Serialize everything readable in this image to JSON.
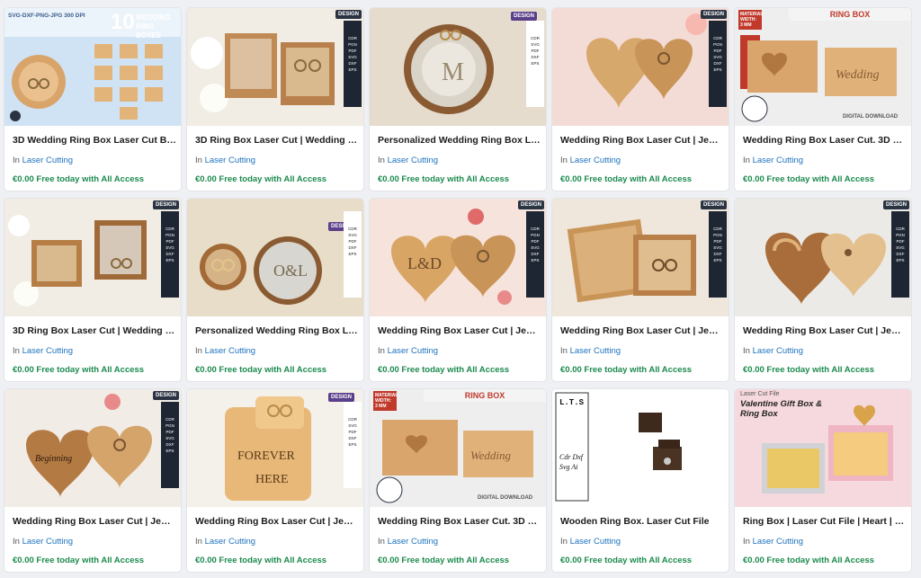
{
  "category_prefix": "In",
  "colors": {
    "title": "#1b1b1b",
    "category_link": "#1e73be",
    "price": "#1b8a4e",
    "card_bg": "#ffffff"
  },
  "products": [
    {
      "title": "3D Wedding Ring Box Laser Cut Bu…",
      "category": "Laser Cutting",
      "price": "€0.00 Free today with All Access",
      "thumb_text_1": "SVG-DXF-PNG-JPG 300 DPI",
      "thumb_text_2": "10",
      "thumb_text_3": "WEDDING RING BOXES"
    },
    {
      "title": "3D Ring Box Laser Cut | Wedding D…",
      "category": "Laser Cutting",
      "price": "€0.00 Free today with All Access"
    },
    {
      "title": "Personalized Wedding Ring Box La…",
      "category": "Laser Cutting",
      "price": "€0.00 Free today with All Access"
    },
    {
      "title": "Wedding Ring Box Laser Cut | Jewe…",
      "category": "Laser Cutting",
      "price": "€0.00 Free today with All Access"
    },
    {
      "title": "Wedding Ring Box Laser Cut. 3D Ri…",
      "category": "Laser Cutting",
      "price": "€0.00 Free today with All Access",
      "thumb_text_1": "RING BOX",
      "thumb_text_2": "MATERIAL WIDTH: 3 MM",
      "thumb_text_3": "DIGITAL DOWNLOAD"
    },
    {
      "title": "3D Ring Box Laser Cut | Wedding D…",
      "category": "Laser Cutting",
      "price": "€0.00 Free today with All Access"
    },
    {
      "title": "Personalized Wedding Ring Box La…",
      "category": "Laser Cutting",
      "price": "€0.00 Free today with All Access"
    },
    {
      "title": "Wedding Ring Box Laser Cut | Jewe…",
      "category": "Laser Cutting",
      "price": "€0.00 Free today with All Access"
    },
    {
      "title": "Wedding Ring Box Laser Cut | Jewe…",
      "category": "Laser Cutting",
      "price": "€0.00 Free today with All Access"
    },
    {
      "title": "Wedding Ring Box Laser Cut | Jewe…",
      "category": "Laser Cutting",
      "price": "€0.00 Free today with All Access"
    },
    {
      "title": "Wedding Ring Box Laser Cut | Jewe…",
      "category": "Laser Cutting",
      "price": "€0.00 Free today with All Access"
    },
    {
      "title": "Wedding Ring Box Laser Cut | Jewe…",
      "category": "Laser Cutting",
      "price": "€0.00 Free today with All Access"
    },
    {
      "title": "Wedding Ring Box Laser Cut. 3D Ri…",
      "category": "Laser Cutting",
      "price": "€0.00 Free today with All Access",
      "thumb_text_1": "RING BOX",
      "thumb_text_2": "MATERIAL WIDTH: 3 MM",
      "thumb_text_3": "DIGITAL DOWNLOAD"
    },
    {
      "title": "Wooden Ring Box. Laser Cut File",
      "category": "Laser Cutting",
      "price": "€0.00 Free today with All Access",
      "thumb_text_1": "L.T.S",
      "thumb_text_2": "Cdr Dxf Svg Ai"
    },
    {
      "title": "Ring Box | Laser Cut File | Heart | Love",
      "category": "Laser Cutting",
      "price": "€0.00 Free today with All Access",
      "thumb_text_1": "Laser Cut File",
      "thumb_text_2": "Valentine Gift Box & Ring Box"
    }
  ],
  "format_strip": [
    "CDR",
    "PGN",
    "PDF",
    "SVG",
    "DXF",
    "EPS"
  ]
}
